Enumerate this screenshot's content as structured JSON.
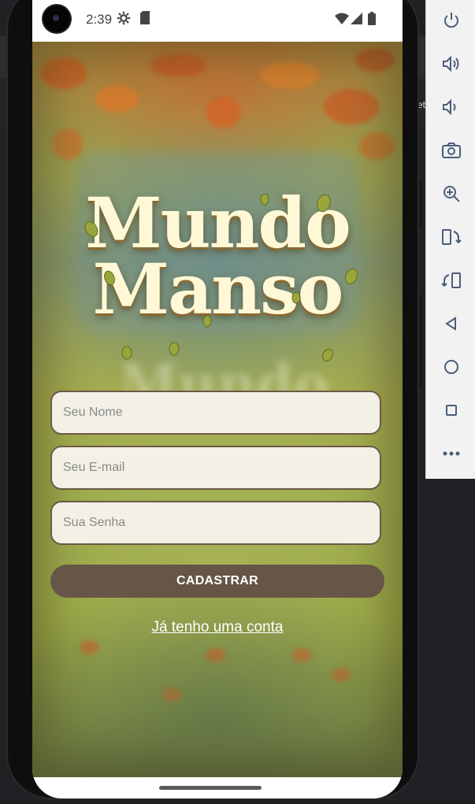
{
  "status_bar": {
    "time": "2:39",
    "icons": [
      "settings-gear-icon",
      "sd-card-icon",
      "wifi-icon",
      "signal-icon",
      "battery-icon"
    ]
  },
  "app": {
    "title_line1": "Mundo",
    "title_line2": "Manso",
    "fields": {
      "name_placeholder": "Seu Nome",
      "email_placeholder": "Seu E-mail",
      "password_placeholder": "Sua Senha"
    },
    "register_button": "CADASTRAR",
    "login_link": "Já tenho uma conta"
  },
  "emulator_panel": {
    "buttons": [
      "power-icon",
      "volume-up-icon",
      "volume-down-icon",
      "camera-icon",
      "zoom-in-icon",
      "rotate-left-icon",
      "rotate-right-icon",
      "back-icon",
      "home-icon",
      "overview-icon",
      "more-icon"
    ]
  },
  "colors": {
    "button_bg": "#675545",
    "field_border": "#6b5a45",
    "title_text": "#fff8d6"
  }
}
